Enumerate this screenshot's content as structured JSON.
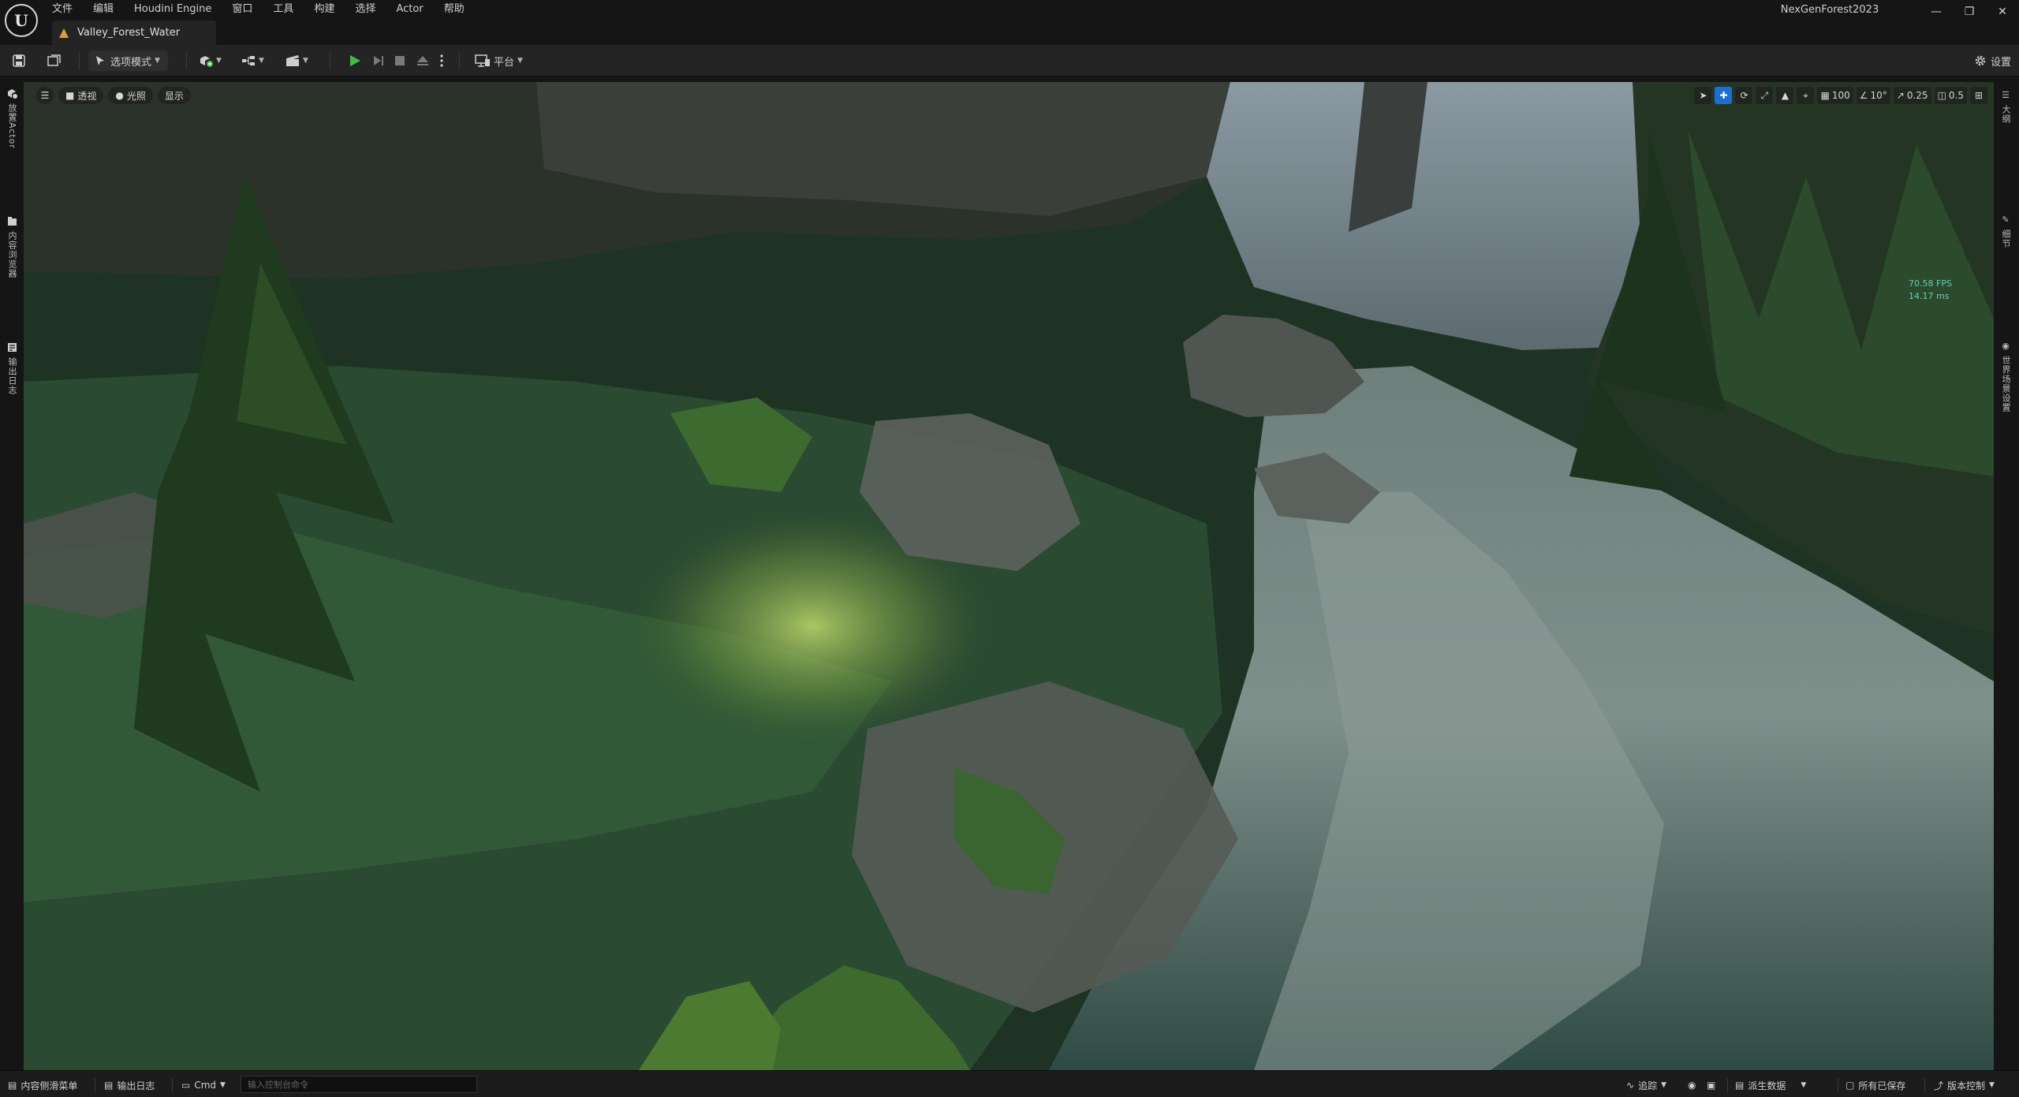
{
  "titlebar": {
    "logo": "unreal-engine-logo",
    "menu": [
      "文件",
      "编辑",
      "Houdini Engine",
      "窗口",
      "工具",
      "构建",
      "选择",
      "Actor",
      "帮助"
    ],
    "document_tab": "Valley_Forest_Water",
    "project_name": "NexGenForest2023",
    "window_controls": [
      "minimize-icon",
      "restore-icon",
      "close-icon"
    ]
  },
  "toolbar": {
    "mode_label": "选项模式",
    "platform_label": "平台",
    "settings_label": "设置",
    "play_color": "#3fbf3f"
  },
  "viewport": {
    "view_mode": "透视",
    "lighting": "光照",
    "show": "显示",
    "grid_snap": "100",
    "rotation_snap": "10°",
    "scale_snap": "0.25",
    "camera_speed": "0.5",
    "fps": "70.58 FPS",
    "frame_ms": "14.17 ms"
  },
  "left_sidebar": {
    "place_actors": "放置Actor",
    "content_browser": "内容浏览器",
    "output_log": "输出日志"
  },
  "right_sidebar": {
    "outliner": "大纲",
    "details": "细节",
    "world_settings": "世界场景设置"
  },
  "statusbar": {
    "content_drawer": "内容侧滑菜单",
    "output_log": "输出日志",
    "cmd": "Cmd",
    "console_placeholder": "输入控制台命令",
    "trace": "追踪",
    "derived_data": "派生数据",
    "all_saved": "所有已保存",
    "source_control": "版本控制"
  }
}
